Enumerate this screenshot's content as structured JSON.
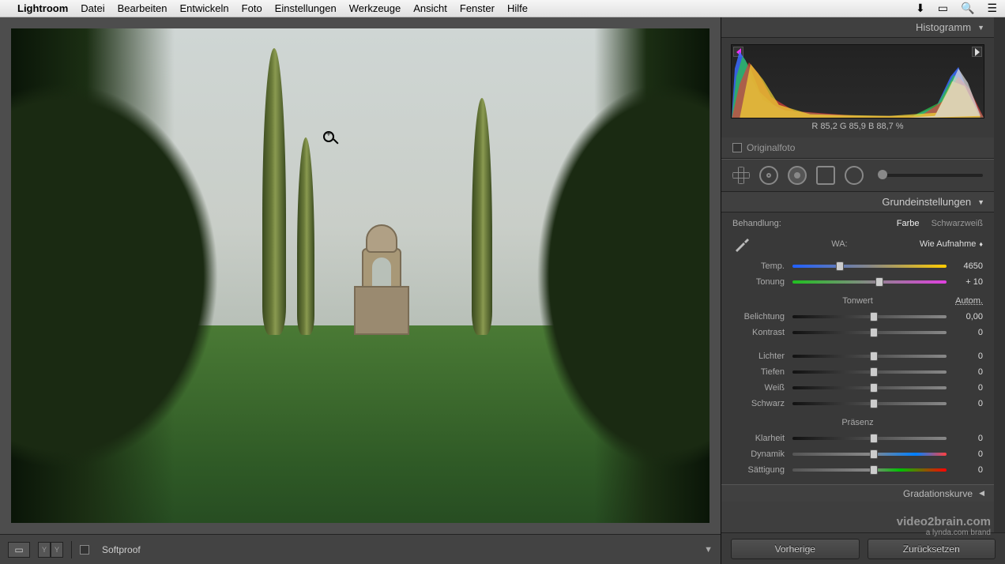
{
  "mac_menu": {
    "app": "Lightroom",
    "items": [
      "Datei",
      "Bearbeiten",
      "Entwickeln",
      "Foto",
      "Einstellungen",
      "Werkzeuge",
      "Ansicht",
      "Fenster",
      "Hilfe"
    ]
  },
  "panels": {
    "histogram": "Histogramm",
    "basic": "Grundeinstellungen",
    "tonecurve": "Gradationskurve"
  },
  "histogram": {
    "readout": "R  85,2   G  85,9   B  88,7  %",
    "original": "Originalfoto"
  },
  "basic": {
    "behandlung": "Behandlung:",
    "farbe": "Farbe",
    "sw": "Schwarzweiß",
    "wa_label": "WA:",
    "wa_value": "Wie Aufnahme",
    "temp": {
      "label": "Temp.",
      "value": "4650",
      "pos": 28
    },
    "tint": {
      "label": "Tonung",
      "value": "+ 10",
      "pos": 54
    },
    "tonwert": "Tonwert",
    "autom": "Autom.",
    "exposure": {
      "label": "Belichtung",
      "value": "0,00",
      "pos": 50
    },
    "contrast": {
      "label": "Kontrast",
      "value": "0",
      "pos": 50
    },
    "highlights": {
      "label": "Lichter",
      "value": "0",
      "pos": 50
    },
    "shadows": {
      "label": "Tiefen",
      "value": "0",
      "pos": 50
    },
    "whites": {
      "label": "Weiß",
      "value": "0",
      "pos": 50
    },
    "blacks": {
      "label": "Schwarz",
      "value": "0",
      "pos": 50
    },
    "presence": "Präsenz",
    "clarity": {
      "label": "Klarheit",
      "value": "0",
      "pos": 50
    },
    "vibrance": {
      "label": "Dynamik",
      "value": "0",
      "pos": 50
    },
    "saturation": {
      "label": "Sättigung",
      "value": "0",
      "pos": 50
    }
  },
  "bottom": {
    "softproof": "Softproof"
  },
  "right_bottom": {
    "prev": "Vorherige",
    "reset": "Zurücksetzen"
  },
  "watermark": {
    "line1": "video2brain.com",
    "line2": "a lynda.com brand"
  }
}
